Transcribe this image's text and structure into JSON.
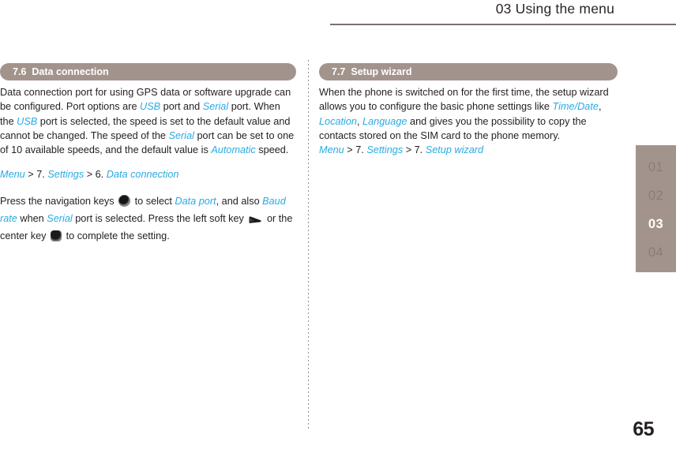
{
  "header": {
    "title": "03 Using the menu"
  },
  "colors": {
    "accent_bar": "#a2948d",
    "highlight_term": "#29abe2",
    "rule": "#7b706c",
    "text": "#231f20",
    "tab_inactive": "#8b7d76",
    "tab_active": "#ffffff"
  },
  "left_column": {
    "section": {
      "number": "7.6",
      "name": "Data connection"
    },
    "paragraph1": {
      "t1": "Data connection port for using GPS data or software upgrade can be configured. Port options are ",
      "h1": "USB",
      "t2": " port and ",
      "h2": "Serial",
      "t3": " port. When the ",
      "h3": "USB",
      "t4": " port is selected, the speed is set to the default value and cannot be changed. The speed of the ",
      "h4": "Serial",
      "t5": " port can be set to one of 10 available speeds, and the default value is ",
      "h5": "Automatic",
      "t6": " speed."
    },
    "menu_path": {
      "m1": "Menu",
      "s1": " > 7. ",
      "m2": "Settings",
      "s2": " > 6. ",
      "m3": "Data connection"
    },
    "paragraph2": {
      "t1": "Press the navigation keys ",
      "icon1": "navigation-key-icon",
      "t2": " to select ",
      "h1": "Data port",
      "t3": ", and also ",
      "h2": "Baud rate",
      "t4": " when ",
      "h3": "Serial",
      "t5": " port is selected. Press the left soft key ",
      "icon2": "left-soft-key-icon",
      "t6": " or the center key ",
      "icon3": "center-key-icon",
      "t7": " to complete the setting."
    }
  },
  "right_column": {
    "section": {
      "number": "7.7",
      "name": "Setup wizard"
    },
    "paragraph1": {
      "t1": "When the phone is switched on for the first time, the setup wizard allows you to configure the basic phone settings like ",
      "h1": "Time/Date",
      "t2": ", ",
      "h2": "Location",
      "t3": ", ",
      "h3": "Language",
      "t4": " and gives you the possibility to copy the contacts stored on the SIM card to the phone memory."
    },
    "menu_path": {
      "m1": "Menu",
      "s1": " > 7. ",
      "m2": "Settings",
      "s2": " > 7. ",
      "m3": "Setup wizard"
    }
  },
  "chapter_rail": {
    "tabs": [
      {
        "label": "01",
        "active": false
      },
      {
        "label": "02",
        "active": false
      },
      {
        "label": "03",
        "active": true
      },
      {
        "label": "04",
        "active": false
      }
    ]
  },
  "page_number": "65"
}
